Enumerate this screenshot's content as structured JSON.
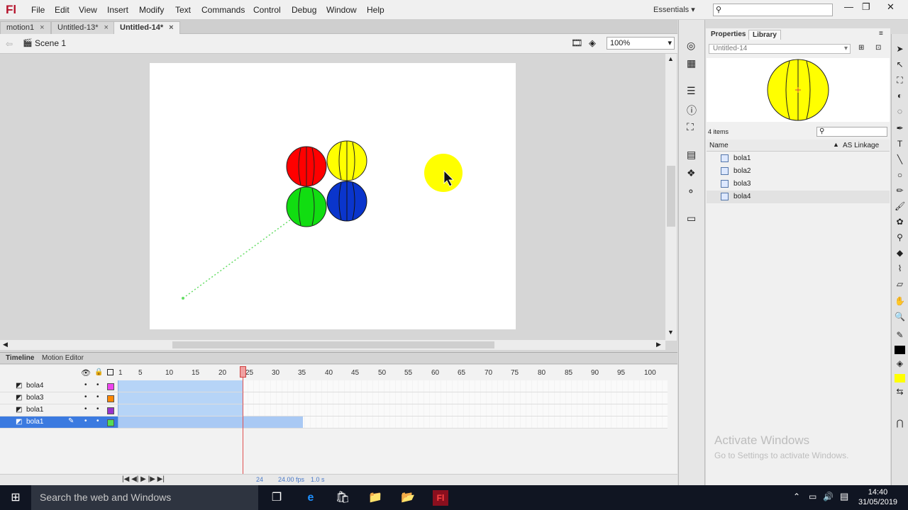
{
  "app": {
    "logo": "Fl",
    "menu": [
      "File",
      "Edit",
      "View",
      "Insert",
      "Modify",
      "Text",
      "Commands",
      "Control",
      "Debug",
      "Window",
      "Help"
    ],
    "workspace": "Essentials",
    "window_controls": [
      "—",
      "❐",
      "✕"
    ]
  },
  "tabs": [
    {
      "label": "motion1",
      "active": false
    },
    {
      "label": "Untitled-13*",
      "active": false
    },
    {
      "label": "Untitled-14*",
      "active": true
    }
  ],
  "scene": {
    "label": "Scene 1",
    "zoom": "100%"
  },
  "stage": {
    "balls": [
      {
        "name": "red-ball",
        "color": "#ff0000"
      },
      {
        "name": "yellow-ball",
        "color": "#ffff00"
      },
      {
        "name": "green-ball",
        "color": "#00dd00"
      },
      {
        "name": "blue-ball",
        "color": "#0033cc"
      },
      {
        "name": "moving-yellow-ball",
        "color": "#ffff00"
      }
    ],
    "path_color": "#66dd66"
  },
  "timeline": {
    "tabs": [
      "Timeline",
      "Motion Editor"
    ],
    "ruler": [
      "1",
      "5",
      "10",
      "15",
      "20",
      "25",
      "30",
      "35",
      "40",
      "45",
      "50",
      "55",
      "60",
      "65",
      "70",
      "75",
      "80",
      "85",
      "90",
      "95",
      "100"
    ],
    "layers": [
      {
        "name": "bola4",
        "color": "#ee44ee",
        "selected": false
      },
      {
        "name": "bola3",
        "color": "#ff8800",
        "selected": false
      },
      {
        "name": "bola1",
        "color": "#9933cc",
        "selected": false
      },
      {
        "name": "bola1",
        "color": "#55dd55",
        "selected": true
      }
    ],
    "current_frame": "24",
    "fps": "24.00 fps",
    "time": "1.0 s"
  },
  "panel": {
    "tabs": [
      "Properties",
      "Library"
    ],
    "doc_select": "Untitled-14",
    "item_count": "4 items",
    "columns": {
      "name": "Name",
      "linkage": "AS Linkage"
    },
    "items": [
      "bola1",
      "bola2",
      "bola3",
      "bola4"
    ],
    "selected_item": "bola4"
  },
  "watermark": {
    "title": "Activate Windows",
    "subtitle": "Go to Settings to activate Windows."
  },
  "taskbar": {
    "search": "Search the web and Windows",
    "time": "14:40",
    "date": "31/05/2019"
  }
}
